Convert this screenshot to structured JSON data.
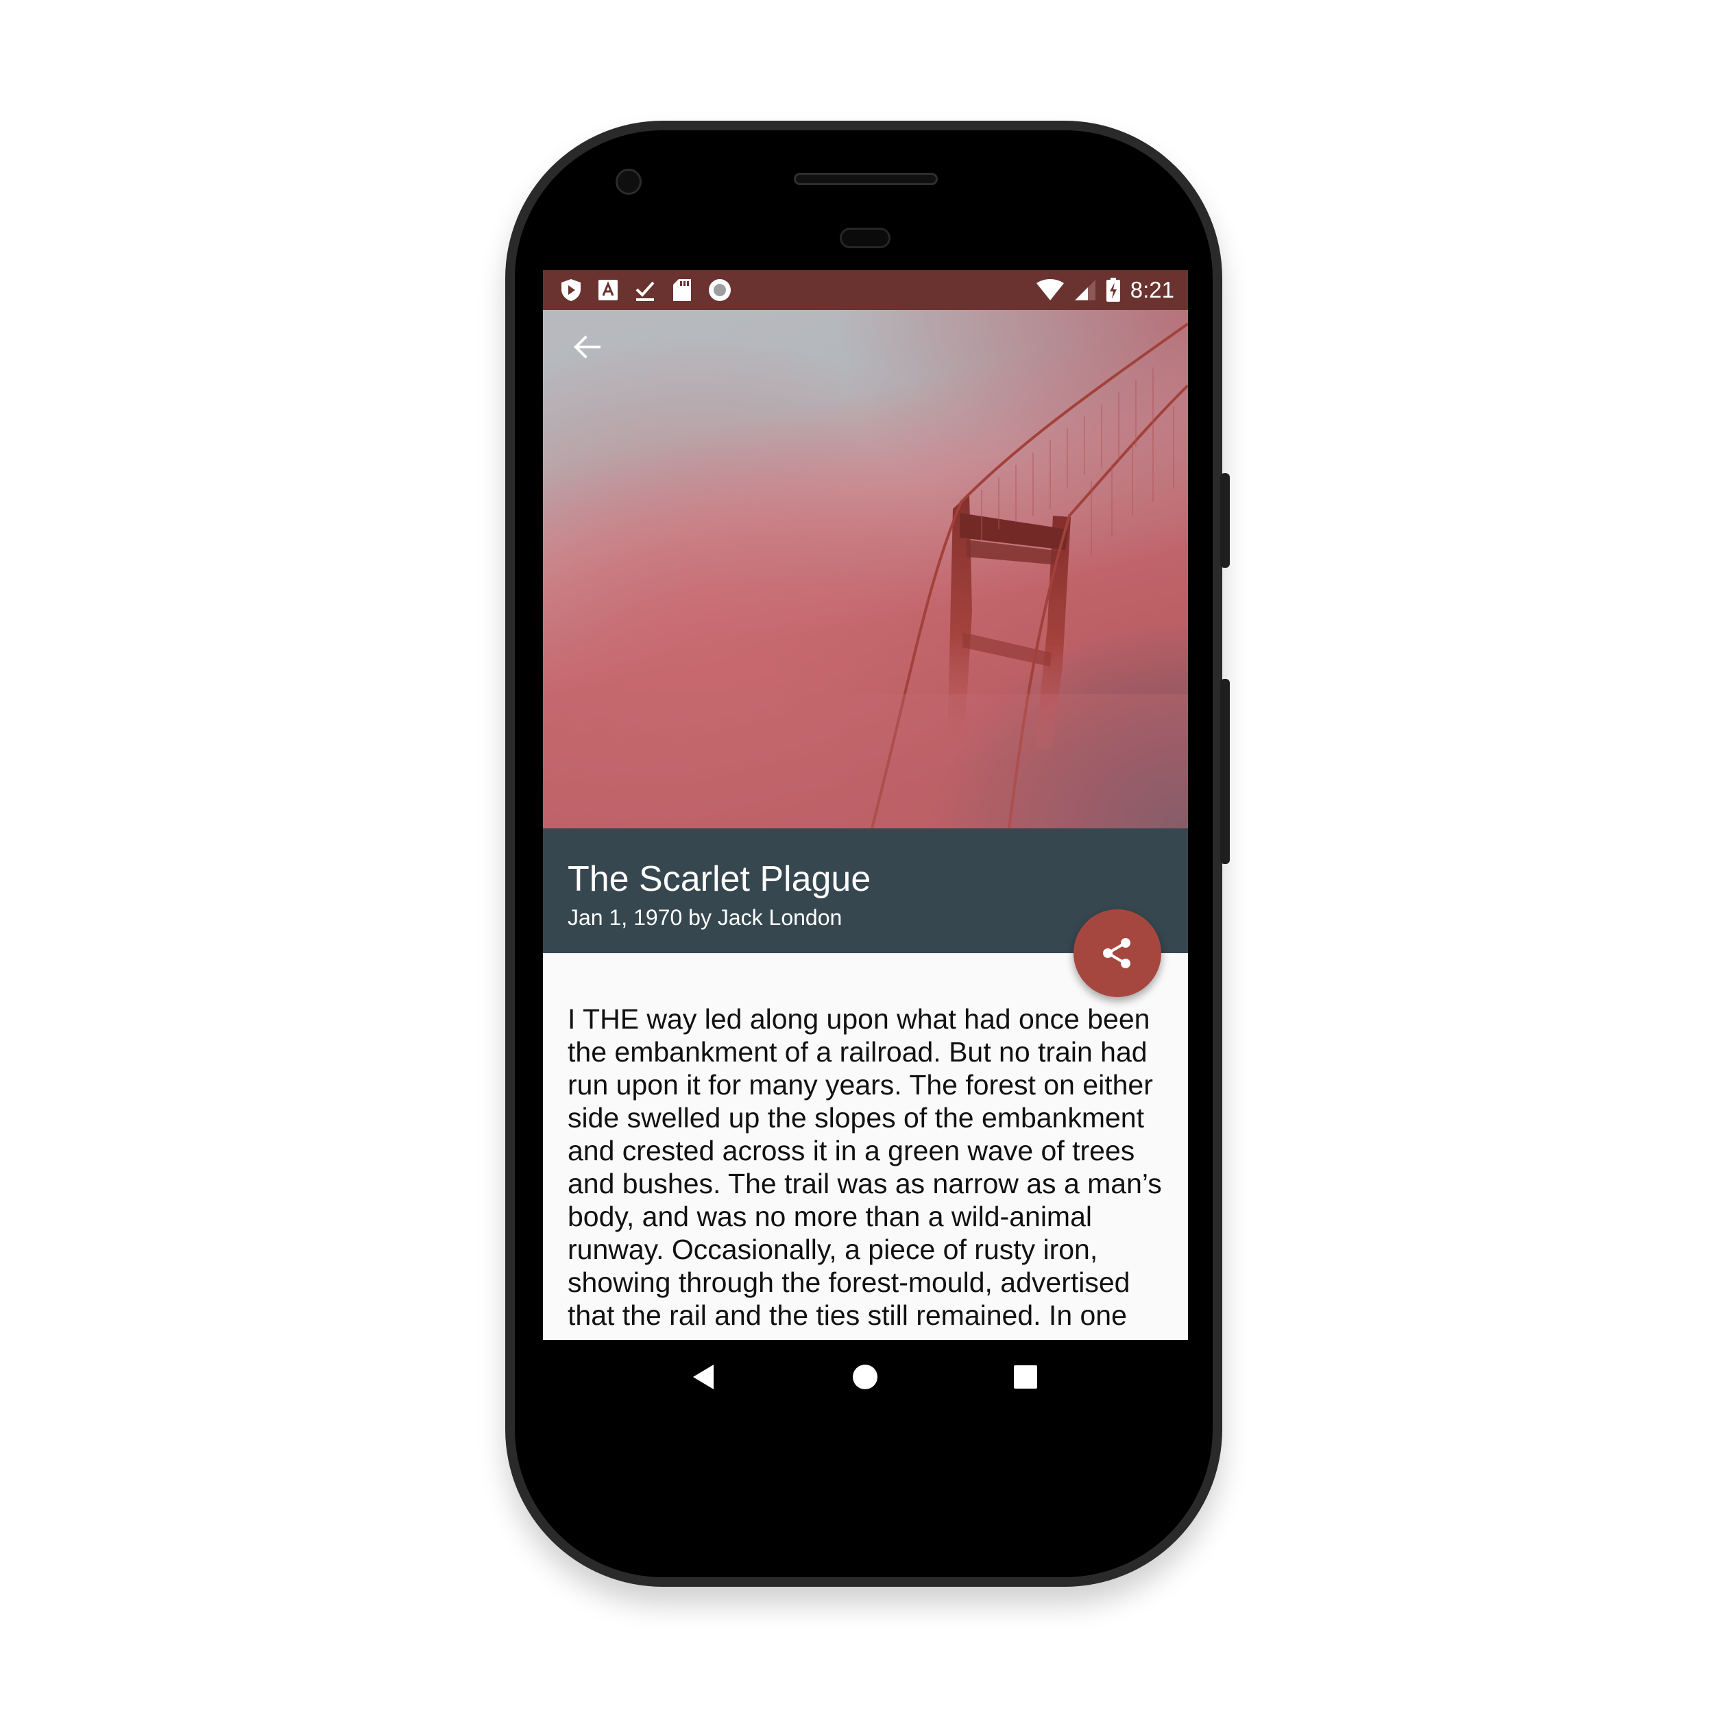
{
  "status_bar": {
    "time": "8:21",
    "left_icons": [
      "shield-play-icon",
      "font-a-icon",
      "download-done-icon",
      "sd-card-icon",
      "record-icon"
    ],
    "right_icons": [
      "wifi-icon",
      "cellular-signal-icon",
      "battery-charging-icon"
    ],
    "color": "#6b332f"
  },
  "toolbar": {
    "back_icon": "arrow-back-icon"
  },
  "article": {
    "title": "The Scarlet Plague",
    "meta": "Jan 1, 1970 by Jack London",
    "body": "I THE way led along upon what had once been the embankment of a railroad. But no train had run upon it for many years. The forest on either side swelled up the slopes of the embankment and crested across it in a green wave of trees and bushes. The trail was as narrow as a man’s body, and was no more than a wild-animal runway. Occasionally, a piece of rusty iron, showing through the forest-mould, advertised that the rail and the ties still remained. In one"
  },
  "fab": {
    "icon": "share-icon",
    "color": "#a6473f"
  },
  "title_bar_color": "#37474f",
  "nav_bar": {
    "back_icon": "nav-back-icon",
    "home_icon": "nav-home-icon",
    "recents_icon": "nav-recents-icon"
  }
}
